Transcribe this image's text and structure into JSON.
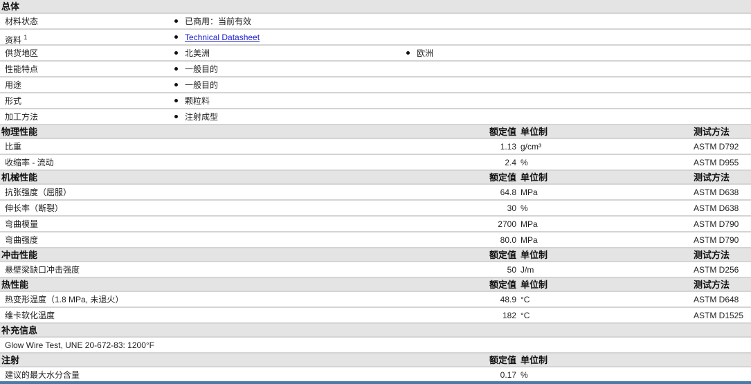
{
  "sections": [
    {
      "title": "总体",
      "type": "general",
      "rows": [
        {
          "label": "材料状态",
          "items": [
            "已商用：当前有效"
          ]
        },
        {
          "label": "资料",
          "sup": "1",
          "items": [
            "Technical Datasheet"
          ],
          "link": true
        },
        {
          "label": "供货地区",
          "items": [
            "北美洲",
            "欧洲"
          ]
        },
        {
          "label": "性能特点",
          "items": [
            "一般目的"
          ]
        },
        {
          "label": "用途",
          "items": [
            "一般目的"
          ]
        },
        {
          "label": "形式",
          "items": [
            "颗粒料"
          ]
        },
        {
          "label": "加工方法",
          "items": [
            "注射成型"
          ]
        }
      ]
    },
    {
      "title": "物理性能",
      "type": "props",
      "col_value": "额定值",
      "col_unit": "单位制",
      "col_test": "测试方法",
      "rows": [
        {
          "label": "比重",
          "value": "1.13",
          "unit": "g/cm³",
          "test": "ASTM D792"
        },
        {
          "label": "收缩率 - 流动",
          "value": "2.4",
          "unit": "%",
          "test": "ASTM D955"
        }
      ]
    },
    {
      "title": "机械性能",
      "type": "props",
      "col_value": "额定值",
      "col_unit": "单位制",
      "col_test": "测试方法",
      "rows": [
        {
          "label": "抗张强度（屈服）",
          "value": "64.8",
          "unit": "MPa",
          "test": "ASTM D638"
        },
        {
          "label": "伸长率（断裂）",
          "value": "30",
          "unit": "%",
          "test": "ASTM D638"
        },
        {
          "label": "弯曲模量",
          "value": "2700",
          "unit": "MPa",
          "test": "ASTM D790"
        },
        {
          "label": "弯曲强度",
          "value": "80.0",
          "unit": "MPa",
          "test": "ASTM D790"
        }
      ]
    },
    {
      "title": "冲击性能",
      "type": "props",
      "col_value": "额定值",
      "col_unit": "单位制",
      "col_test": "测试方法",
      "rows": [
        {
          "label": "悬壁梁缺口冲击强度",
          "value": "50",
          "unit": "J/m",
          "test": "ASTM D256"
        }
      ]
    },
    {
      "title": "热性能",
      "type": "props",
      "col_value": "额定值",
      "col_unit": "单位制",
      "col_test": "测试方法",
      "rows": [
        {
          "label": "热变形温度（1.8 MPa, 未退火）",
          "value": "48.9",
          "unit": "°C",
          "test": "ASTM D648"
        },
        {
          "label": "维卡软化温度",
          "value": "182",
          "unit": "°C",
          "test": "ASTM D1525"
        }
      ]
    },
    {
      "title": "补充信息",
      "type": "text",
      "rows": [
        {
          "label": "Glow Wire Test, UNE 20-672-83: 1200°F"
        }
      ]
    },
    {
      "title": "注射",
      "type": "props",
      "col_value": "额定值",
      "col_unit": "单位制",
      "rows": [
        {
          "label": "建议的最大水分含量",
          "value": "0.17",
          "unit": "%"
        }
      ]
    }
  ]
}
